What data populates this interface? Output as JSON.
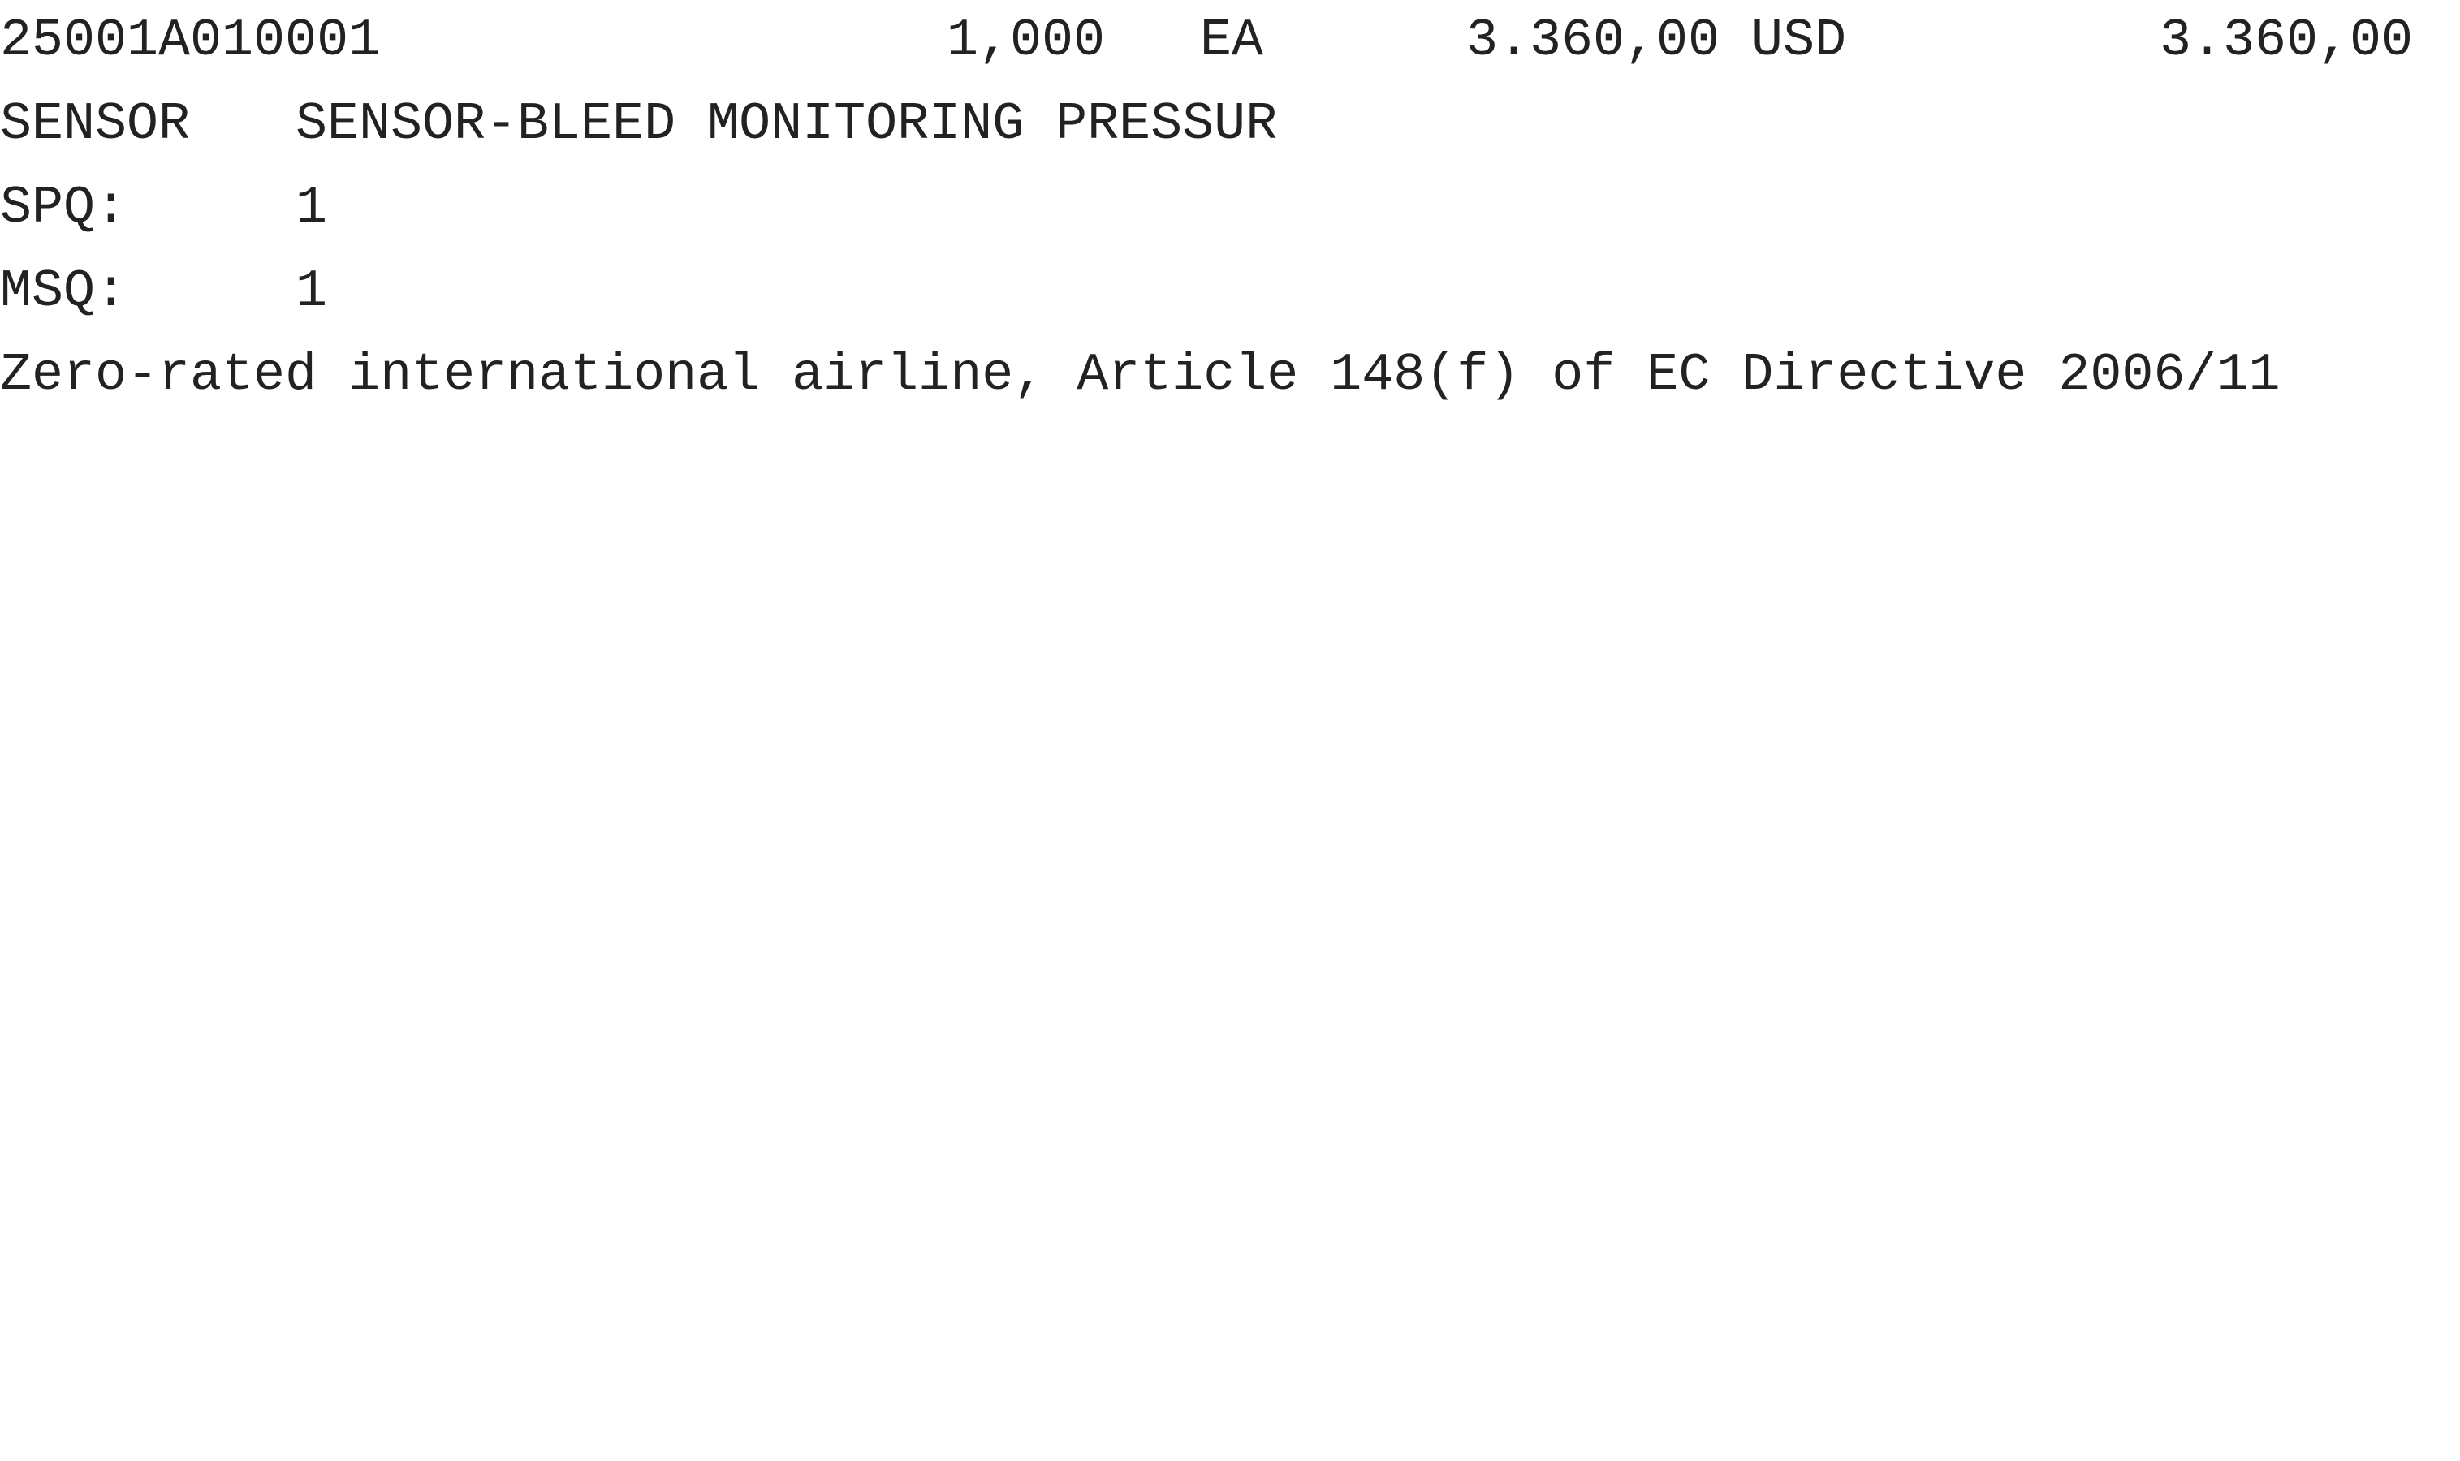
{
  "item_row": {
    "part_number": "25001A010001",
    "quantity": "1,000",
    "unit": "EA",
    "unit_price": "3.360,00 USD",
    "line_total": "3.360,00"
  },
  "description_row": {
    "label": "SENSOR",
    "text": "SENSOR-BLEED MONITORING PRESSUR"
  },
  "spq_row": {
    "label": "SPQ:",
    "value": "1"
  },
  "msq_row": {
    "label": "MSQ:",
    "value": "1"
  },
  "tax_note": "Zero-rated international airline, Article 148(f) of EC Directive 2006/11"
}
